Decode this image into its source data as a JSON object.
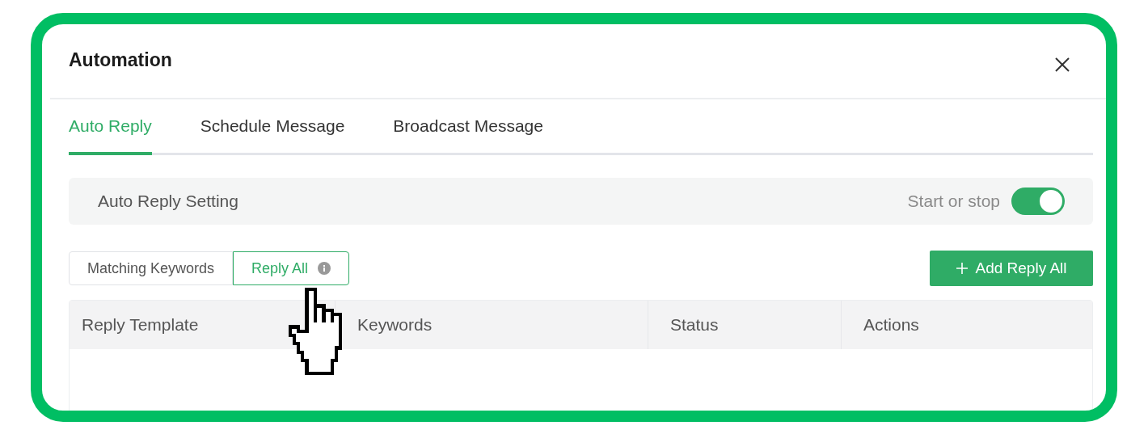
{
  "window": {
    "title": "Automation"
  },
  "tabs": [
    {
      "label": "Auto Reply",
      "selected": true
    },
    {
      "label": "Schedule Message",
      "selected": false
    },
    {
      "label": "Broadcast Message",
      "selected": false
    }
  ],
  "setting": {
    "label": "Auto Reply Setting",
    "toggle_label": "Start or stop",
    "on": true
  },
  "mode_tabs": [
    {
      "label": "Matching Keywords",
      "selected": false,
      "info": false
    },
    {
      "label": "Reply All",
      "selected": true,
      "info": true
    }
  ],
  "add_button": {
    "label": "Add Reply All"
  },
  "table": {
    "columns": [
      "Reply Template",
      "Keywords",
      "Status",
      "Actions"
    ]
  }
}
